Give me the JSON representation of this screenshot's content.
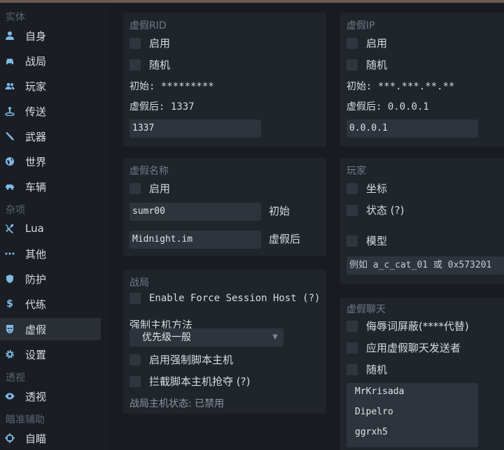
{
  "sidebar": {
    "sections": [
      {
        "title": "实体"
      },
      {
        "title": "杂项"
      },
      {
        "title": "透视"
      },
      {
        "title": "瞄准辅助"
      }
    ],
    "items": [
      {
        "label": "自身",
        "icon": "person-icon"
      },
      {
        "label": "战局",
        "icon": "car-session-icon"
      },
      {
        "label": "玩家",
        "icon": "players-icon"
      },
      {
        "label": "传送",
        "icon": "teleport-icon"
      },
      {
        "label": "武器",
        "icon": "weapon-icon"
      },
      {
        "label": "世界",
        "icon": "globe-icon"
      },
      {
        "label": "车辆",
        "icon": "vehicle-icon"
      },
      {
        "label": "Lua",
        "icon": "tools-icon"
      },
      {
        "label": "其他",
        "icon": "more-icon"
      },
      {
        "label": "防护",
        "icon": "shield-icon"
      },
      {
        "label": "代练",
        "icon": "dollar-icon"
      },
      {
        "label": "虚假",
        "icon": "mask-icon",
        "active": true
      },
      {
        "label": "设置",
        "icon": "gear-icon"
      },
      {
        "label": "透视",
        "icon": "eye-icon"
      },
      {
        "label": "自瞄",
        "icon": "crosshair-icon"
      }
    ]
  },
  "fake_rid": {
    "title": "虚假RID",
    "enable": "启用",
    "random": "随机",
    "initial": "初始: *********",
    "after": "虚假后: 1337",
    "value": "1337"
  },
  "fake_ip": {
    "title": "虚假IP",
    "enable": "启用",
    "random": "随机",
    "initial": "初始: ***.***.**.**",
    "after": "虚假后: 0.0.0.1",
    "value": "0.0.0.1"
  },
  "fake_name": {
    "title": "虚假名称",
    "enable": "启用",
    "initial_value": "sumr00",
    "initial_label": "初始",
    "fake_value": "Midnight.im",
    "fake_label": "虚假后"
  },
  "player": {
    "title": "玩家",
    "coords": "坐标",
    "status": "状态 (?)",
    "model": "模型",
    "model_placeholder": "例如 a_c_cat_01 或 0x573201"
  },
  "session": {
    "title": "战局",
    "force_host": "Enable Force Session Host (?)",
    "method_label": "强制主机方法",
    "method_value": "优先级一般",
    "script_host": "启用强制脚本主机",
    "intercept": "拦截脚本主机抢夺 (?)",
    "status": "战局主机状态: 已禁用"
  },
  "fake_chat": {
    "title": "虚假聊天",
    "profanity": "侮辱词屏蔽(****代替)",
    "apply_sender": "应用虚假聊天发送者",
    "random": "随机",
    "senders": [
      "MrKrisada",
      "Dipelro",
      "ggrxh5"
    ]
  }
}
